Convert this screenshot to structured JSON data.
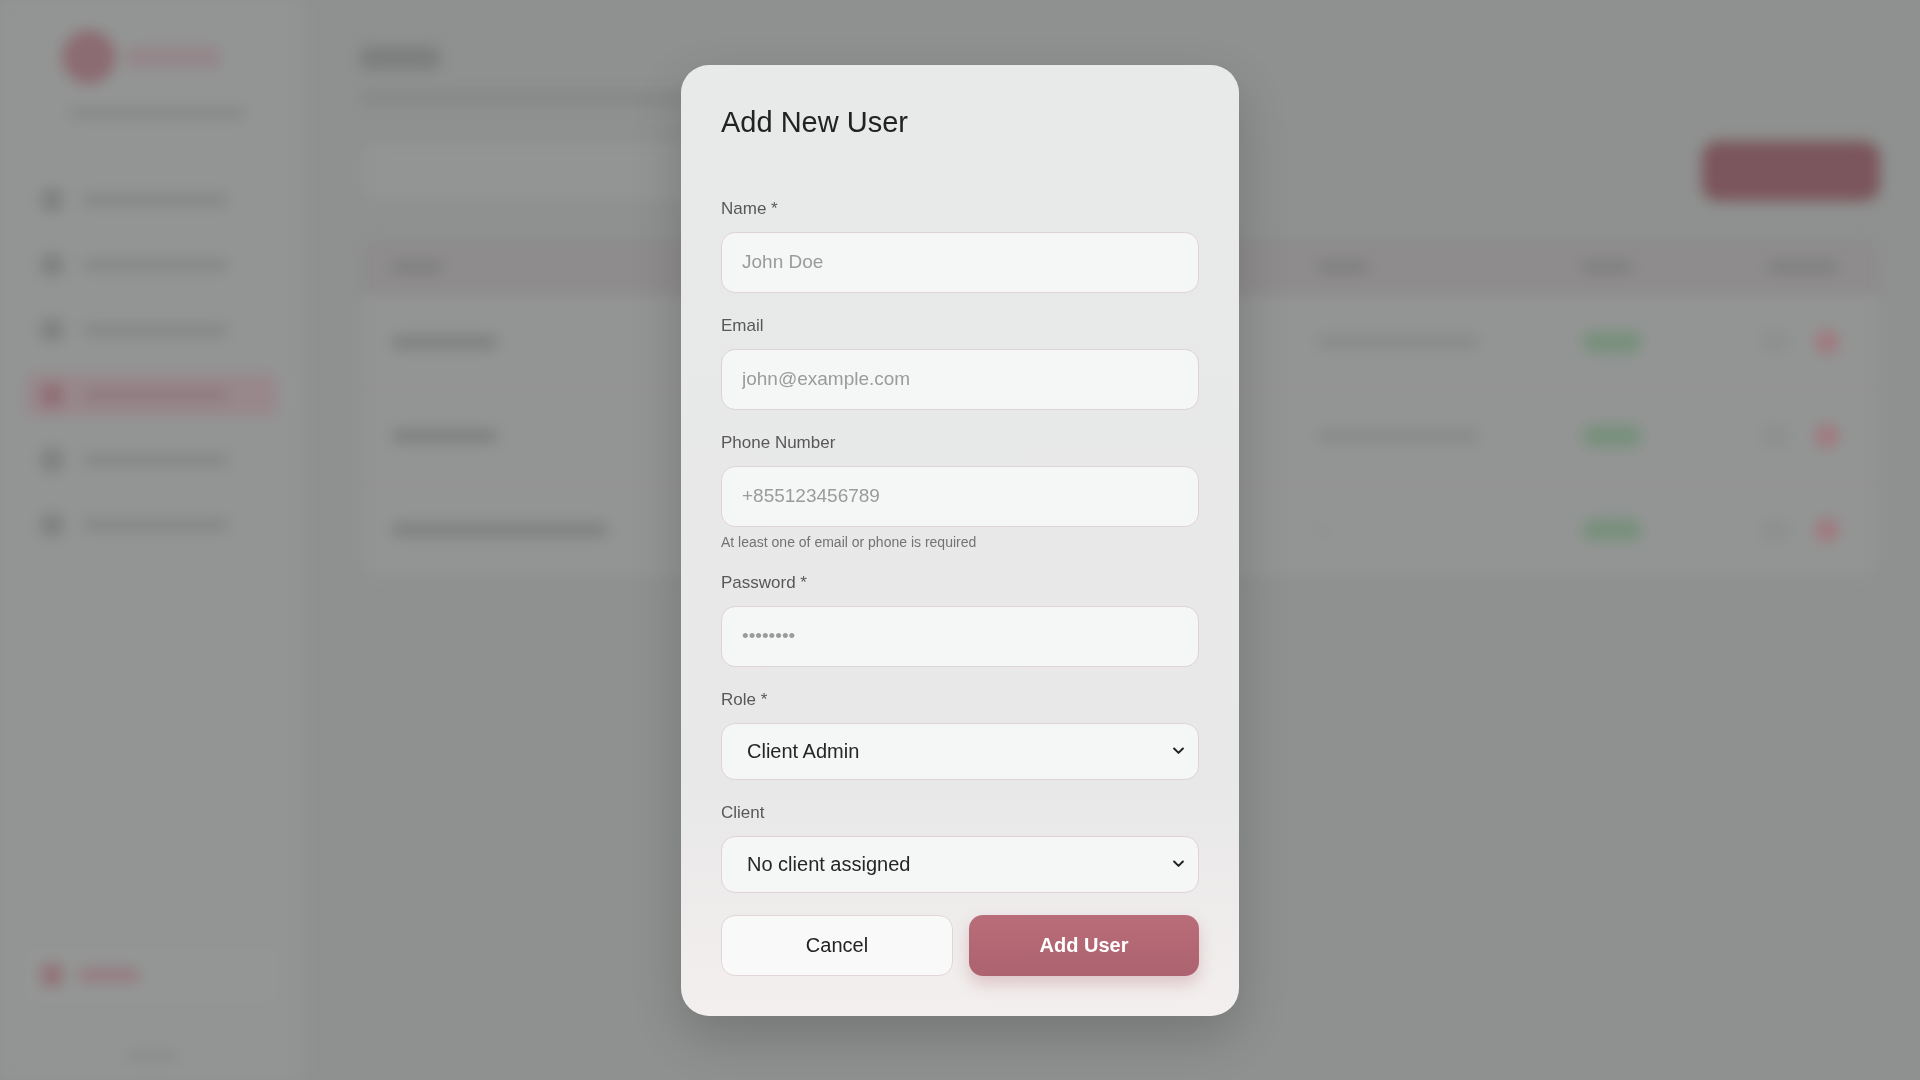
{
  "dialog": {
    "title": "Add New User",
    "fields": [
      {
        "kind": "input",
        "label": "Name *",
        "placeholder": "John Doe"
      },
      {
        "kind": "input",
        "label": "Email",
        "placeholder": "john@example.com"
      },
      {
        "kind": "input",
        "label": "Phone Number",
        "placeholder": "+855123456789",
        "hint": "At least one of email or phone is required"
      },
      {
        "kind": "input",
        "label": "Password *",
        "placeholder": "••••••••"
      },
      {
        "kind": "select",
        "label": "Role *",
        "value": "Client Admin"
      },
      {
        "kind": "select",
        "label": "Client",
        "value": "No client assigned"
      }
    ],
    "buttons": [
      {
        "kind": "secondary",
        "label": "Cancel"
      },
      {
        "kind": "primary",
        "label": "Add User"
      }
    ]
  }
}
